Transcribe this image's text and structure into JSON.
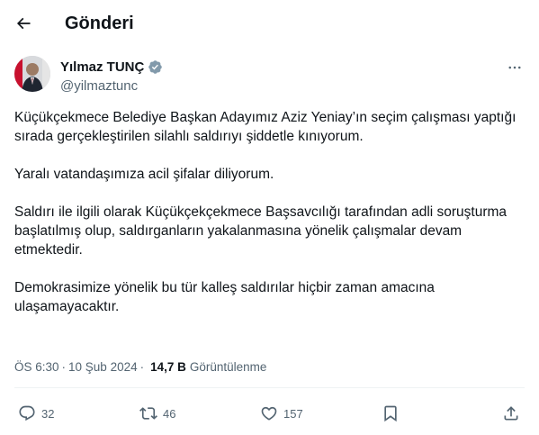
{
  "header": {
    "title": "Gönderi",
    "back_icon": "arrow-left-icon"
  },
  "author": {
    "name": "Yılmaz TUNÇ",
    "handle": "@yilmaztunc",
    "verified_color": "#829aab"
  },
  "tweet": {
    "paragraphs": [
      "Küçükçekmece Belediye Başkan Adayımız Aziz Yeniay’ın seçim çalışması yaptığı sırada gerçekleştirilen silahlı saldırıyı şiddetle kınıyorum.",
      "Yaralı vatandaşımıza acil şifalar diliyorum.",
      "Saldırı ile ilgili olarak Küçükçekçekmece Başsavcılığı tarafından adli soruşturma başlatılmış olup, saldırganların yakalanmasına yönelik çalışmalar devam etmektedir.",
      "Demokrasimize yönelik bu tür kalleş saldırılar hiçbir zaman amacına ulaşamayacaktır."
    ]
  },
  "meta": {
    "time": "ÖS 6:30",
    "separator": "·",
    "date": "10 Şub 2024",
    "views_count": "14,7 B",
    "views_label": "Görüntülenme"
  },
  "actions": {
    "replies": "32",
    "reposts": "46",
    "likes": "157"
  },
  "colors": {
    "text": "#0f1419",
    "secondary": "#536471",
    "divider": "#eff3f4"
  }
}
